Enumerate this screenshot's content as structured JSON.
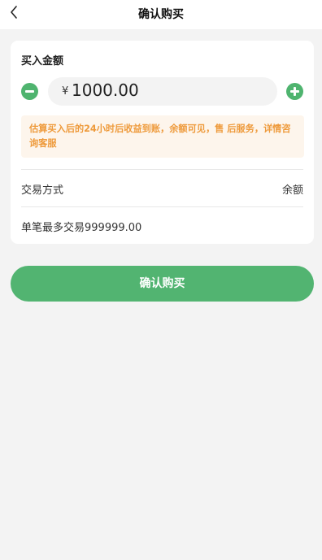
{
  "header": {
    "title": "确认购买",
    "back_icon": "chevron-left-icon"
  },
  "purchase": {
    "section_title": "买入金额",
    "currency_symbol": "¥",
    "amount_value": "1000.00",
    "minus_icon": "minus-circle-icon",
    "plus_icon": "plus-circle-icon",
    "notice": "估算买入后的24小时后收益到账，余额可见，售 后服务，详情咨询客服",
    "payment_method_label": "交易方式",
    "payment_method_value": "余额",
    "limit_text": "单笔最多交易999999.00"
  },
  "actions": {
    "confirm_label": "确认购买"
  },
  "colors": {
    "accent_green": "#52b471",
    "notice_text": "#ee9a3b",
    "notice_bg": "#fdf5ec",
    "page_bg": "#f3f3f3"
  }
}
